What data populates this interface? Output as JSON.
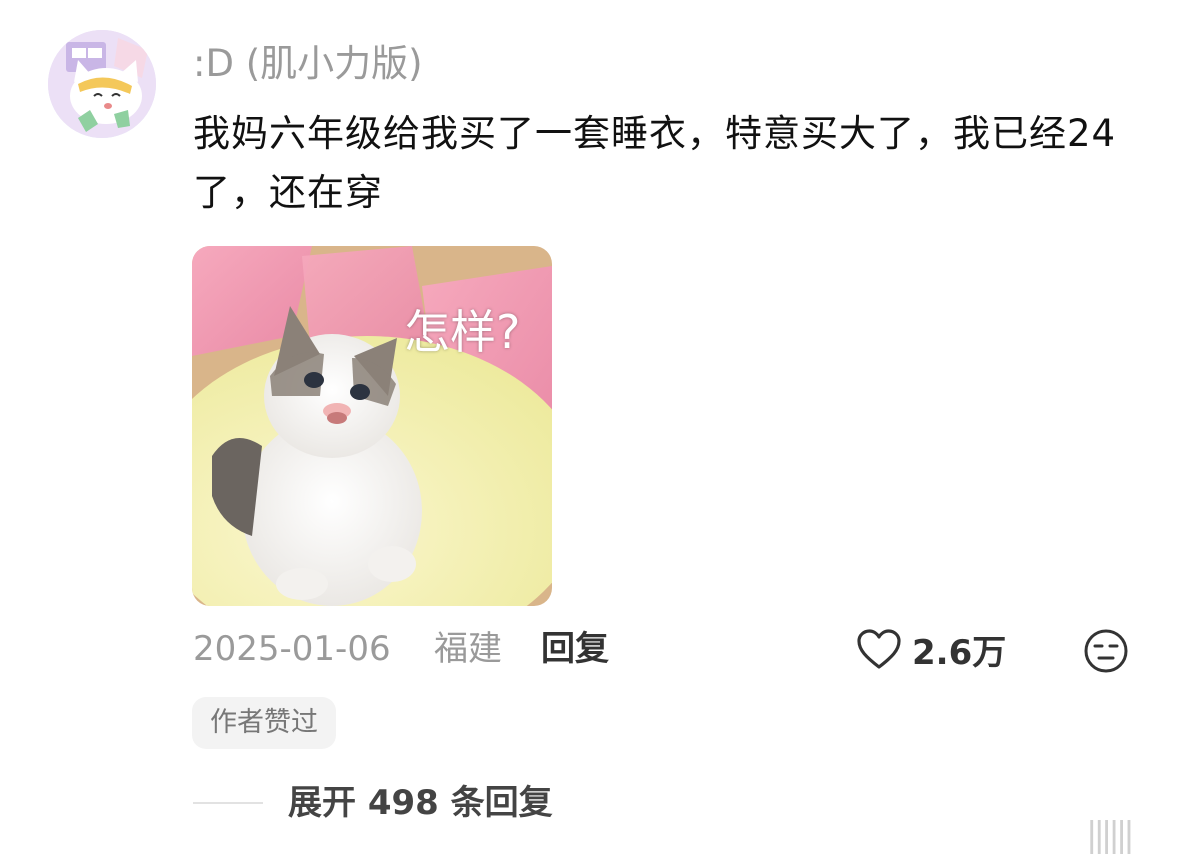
{
  "comment": {
    "username": ":D (肌小力版)",
    "text": "我妈六年级给我买了一套睡衣，特意买大了，我已经24了，还在穿",
    "image_caption": "怎样?",
    "date": "2025-01-06",
    "location": "福建",
    "reply_label": "回复",
    "like_count": "2.6万",
    "author_badge": "作者赞过",
    "expand_replies_label": "展开 498 条回复",
    "icons": {
      "like": "heart-outline-icon",
      "reaction": "neutral-face-icon"
    }
  },
  "watermark": "||||||"
}
